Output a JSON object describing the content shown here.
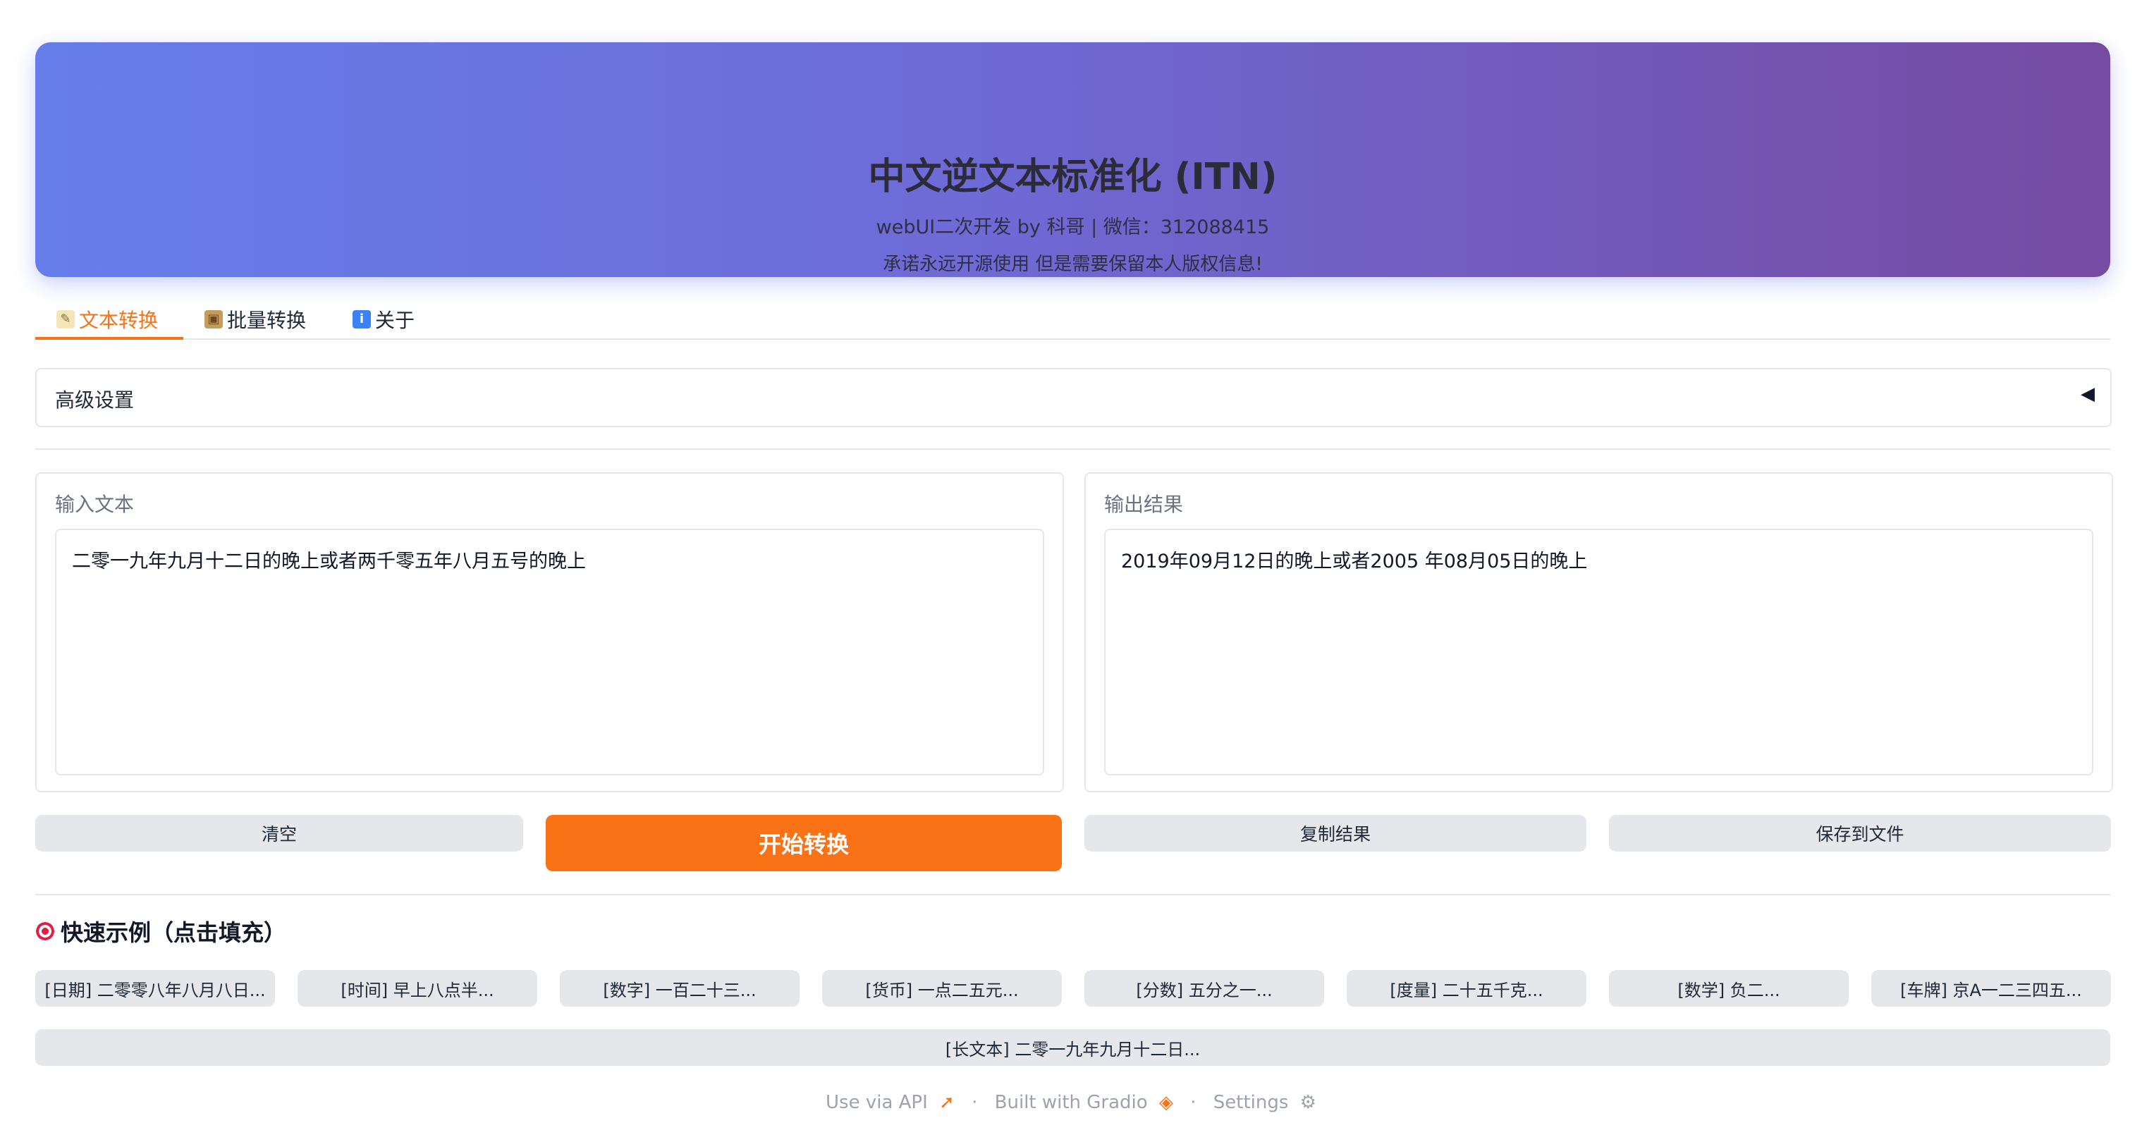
{
  "header": {
    "title": "中文逆文本标准化 (ITN)",
    "subtitle": "webUI二次开发 by 科哥 | 微信：312088415",
    "notice": "承诺永远开源使用 但是需要保留本人版权信息!"
  },
  "tabs": [
    {
      "label": "文本转换",
      "icon": "memo-icon",
      "active": true
    },
    {
      "label": "批量转换",
      "icon": "package-icon",
      "active": false
    },
    {
      "label": "关于",
      "icon": "info-icon",
      "active": false
    }
  ],
  "advanced": {
    "label": "高级设置"
  },
  "input": {
    "label": "输入文本",
    "value": "二零一九年九月十二日的晚上或者两千零五年八月五号的晚上"
  },
  "output": {
    "label": "输出结果",
    "value": "2019年09月12日的晚上或者2005 年08月05日的晚上"
  },
  "buttons": {
    "clear": "清空",
    "start": "开始转换",
    "copy": "复制结果",
    "save": "保存到文件"
  },
  "examples": {
    "title": "快速示例（点击填充）",
    "items": [
      "[日期] 二零零八年八月八日...",
      "[时间] 早上八点半...",
      "[数字] 一百二十三...",
      "[货币] 一点二五元...",
      "[分数] 五分之一...",
      "[度量] 二十五千克...",
      "[数学] 负二...",
      "[车牌] 京A一二三四五..."
    ],
    "long": "[长文本] 二零一九年九月十二日..."
  },
  "footer": {
    "api": "Use via API",
    "gradio": "Built with Gradio",
    "settings": "Settings"
  },
  "colors": {
    "accent": "#f97316",
    "banner_start": "#667eea",
    "banner_end": "#764ba2"
  }
}
